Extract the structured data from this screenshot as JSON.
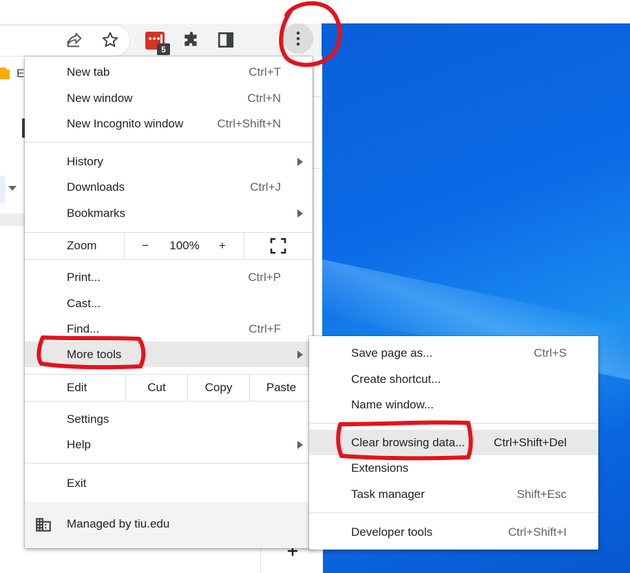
{
  "toolbar": {
    "extension_badge": "5",
    "bookmark_stub": "E"
  },
  "menu": {
    "new_tab": {
      "label": "New tab",
      "shortcut": "Ctrl+T"
    },
    "new_window": {
      "label": "New window",
      "shortcut": "Ctrl+N"
    },
    "new_incognito": {
      "label": "New Incognito window",
      "shortcut": "Ctrl+Shift+N"
    },
    "history": {
      "label": "History"
    },
    "downloads": {
      "label": "Downloads",
      "shortcut": "Ctrl+J"
    },
    "bookmarks": {
      "label": "Bookmarks"
    },
    "zoom": {
      "label": "Zoom",
      "minus": "−",
      "value": "100%",
      "plus": "+"
    },
    "print": {
      "label": "Print...",
      "shortcut": "Ctrl+P"
    },
    "cast": {
      "label": "Cast..."
    },
    "find": {
      "label": "Find...",
      "shortcut": "Ctrl+F"
    },
    "more_tools": {
      "label": "More tools"
    },
    "edit": {
      "label": "Edit",
      "cut": "Cut",
      "copy": "Copy",
      "paste": "Paste"
    },
    "settings": {
      "label": "Settings"
    },
    "help": {
      "label": "Help"
    },
    "exit": {
      "label": "Exit"
    },
    "managed": {
      "label": "Managed by tiu.edu"
    }
  },
  "submenu": {
    "save_page": {
      "label": "Save page as...",
      "shortcut": "Ctrl+S"
    },
    "create_shortcut": {
      "label": "Create shortcut..."
    },
    "name_window": {
      "label": "Name window..."
    },
    "clear_browsing": {
      "label": "Clear browsing data...",
      "shortcut": "Ctrl+Shift+Del"
    },
    "extensions": {
      "label": "Extensions"
    },
    "task_manager": {
      "label": "Task manager",
      "shortcut": "Shift+Esc"
    },
    "developer_tools": {
      "label": "Developer tools",
      "shortcut": "Ctrl+Shift+I"
    }
  },
  "colors": {
    "annotation": "#e5121b",
    "desktop_blue": "#0b6ae6",
    "highlight": "#e8e8e8"
  }
}
